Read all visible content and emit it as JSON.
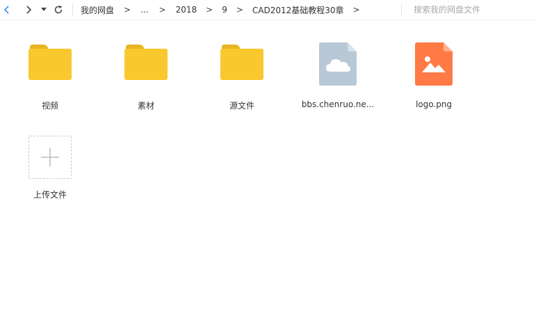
{
  "toolbar": {
    "icons": [
      "chevron-left-icon",
      "chevron-right-icon",
      "caret-down-icon",
      "refresh-icon"
    ],
    "colors": {
      "back_arrow": "#3b8ff3",
      "nav_icon": "#444444"
    }
  },
  "breadcrumb": {
    "items": [
      "我的网盘",
      "...",
      "2018",
      "9",
      "CAD2012基础教程30章"
    ],
    "separator": ">"
  },
  "search": {
    "placeholder": "搜索我的网盘文件"
  },
  "items": [
    {
      "label": "视频",
      "type": "folder"
    },
    {
      "label": "素材",
      "type": "folder"
    },
    {
      "label": "源文件",
      "type": "folder"
    },
    {
      "label": "bbs.chenruo.ne...",
      "type": "cloud-file"
    },
    {
      "label": "logo.png",
      "type": "image-file"
    }
  ],
  "upload": {
    "label": "上传文件",
    "icon": "plus-icon"
  },
  "colors": {
    "folder": "#f8c82e",
    "folder_tab": "#e9b521",
    "cloud_file": "#b9c8d6",
    "image_file": "#ff7a45"
  }
}
